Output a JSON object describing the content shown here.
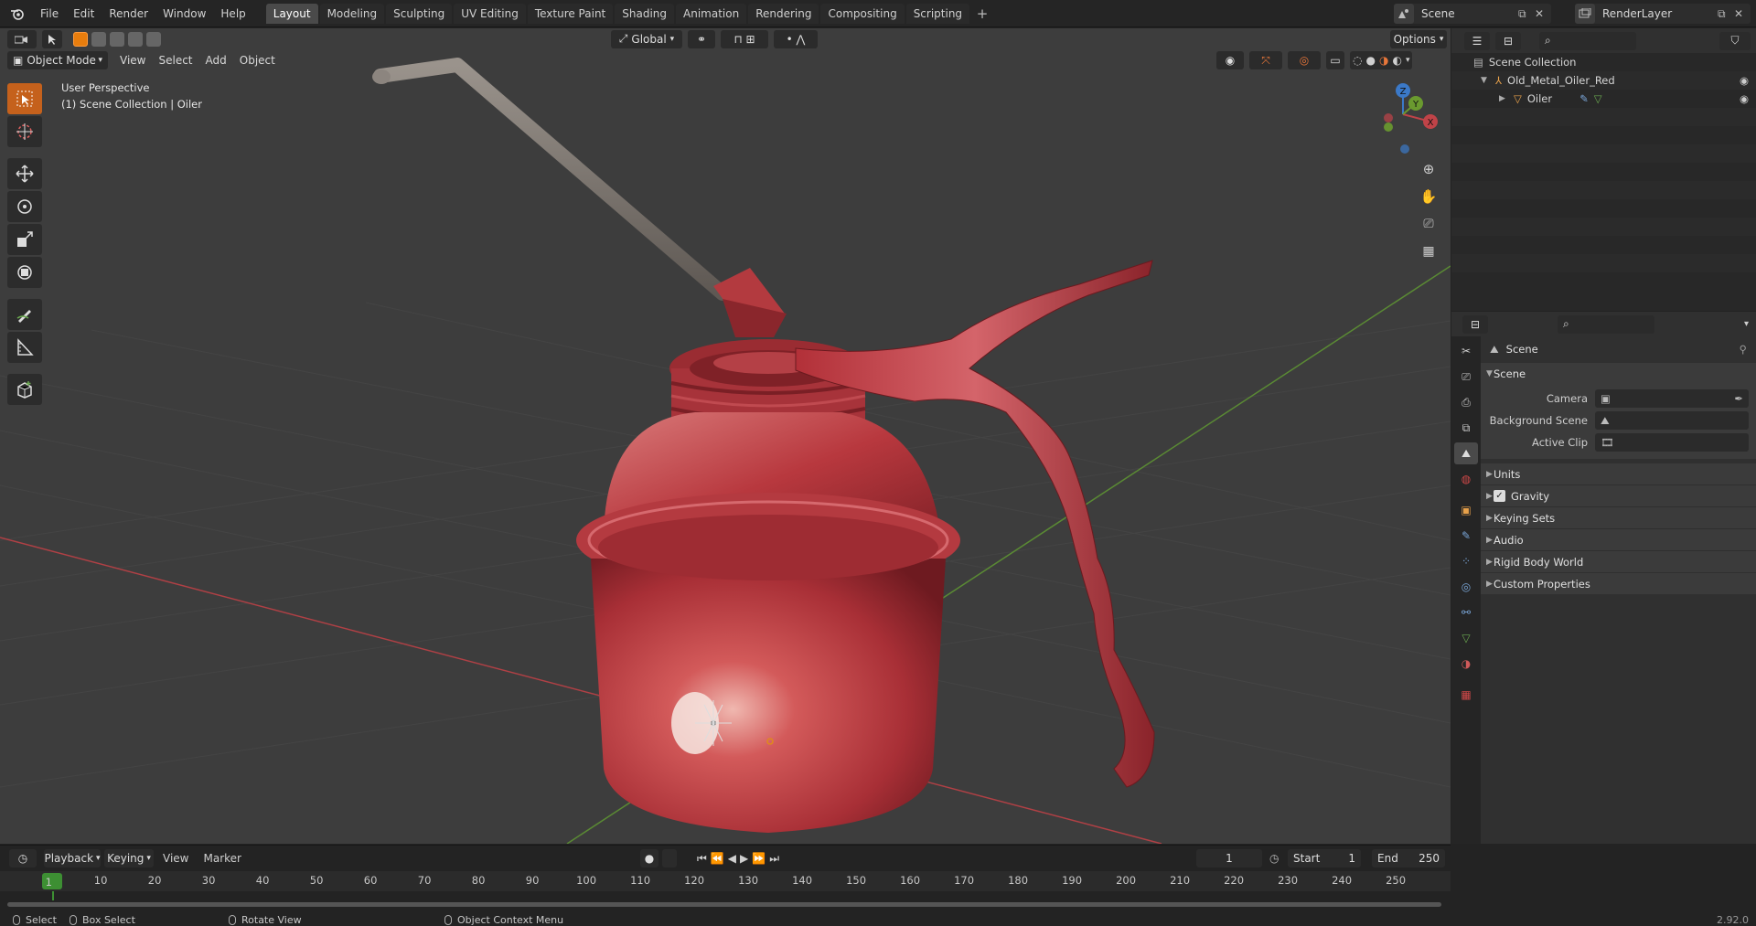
{
  "topbar": {
    "menus": [
      "File",
      "Edit",
      "Render",
      "Window",
      "Help"
    ],
    "workspaces": [
      "Layout",
      "Modeling",
      "Sculpting",
      "UV Editing",
      "Texture Paint",
      "Shading",
      "Animation",
      "Rendering",
      "Compositing",
      "Scripting"
    ],
    "active_workspace": "Layout",
    "scene_name": "Scene",
    "view_layer": "RenderLayer"
  },
  "viewport": {
    "mode": "Object Mode",
    "menus": [
      "View",
      "Select",
      "Add",
      "Object"
    ],
    "transform_orientation": "Global",
    "options_label": "Options",
    "perspective": "User Perspective",
    "collection_info": "(1) Scene Collection | Oiler",
    "gizmo": {
      "x": "X",
      "y": "Y",
      "z": "Z"
    }
  },
  "outliner": {
    "root": "Scene Collection",
    "items": [
      {
        "label": "Old_Metal_Oiler_Red",
        "depth": 1
      },
      {
        "label": "Oiler",
        "depth": 2
      }
    ]
  },
  "properties": {
    "context": "Scene",
    "panel_title": "Scene",
    "fields": [
      {
        "label": "Camera",
        "value": ""
      },
      {
        "label": "Background Scene",
        "value": ""
      },
      {
        "label": "Active Clip",
        "value": ""
      }
    ],
    "sections": [
      "Units",
      "Gravity",
      "Keying Sets",
      "Audio",
      "Rigid Body World",
      "Custom Properties"
    ],
    "gravity_checked": true
  },
  "timeline": {
    "menus": [
      "Playback",
      "Keying",
      "View",
      "Marker"
    ],
    "current_frame": "1",
    "start_label": "Start",
    "start_value": "1",
    "end_label": "End",
    "end_value": "250",
    "ticks": [
      "10",
      "20",
      "30",
      "40",
      "50",
      "60",
      "70",
      "80",
      "90",
      "100",
      "110",
      "120",
      "130",
      "140",
      "150",
      "160",
      "170",
      "180",
      "190",
      "200",
      "210",
      "220",
      "230",
      "240",
      "250"
    ],
    "playhead": "1"
  },
  "statusbar": {
    "select": "Select",
    "box_select": "Box Select",
    "rotate_view": "Rotate View",
    "context_menu": "Object Context Menu",
    "version": "2.92.0"
  },
  "colors": {
    "accent": "#4772b3",
    "active_tool": "#e87d0d",
    "oiler_red": "#c8383e",
    "x_axis": "#c04348",
    "y_axis": "#6a9a2f",
    "z_axis": "#3b79c8"
  }
}
